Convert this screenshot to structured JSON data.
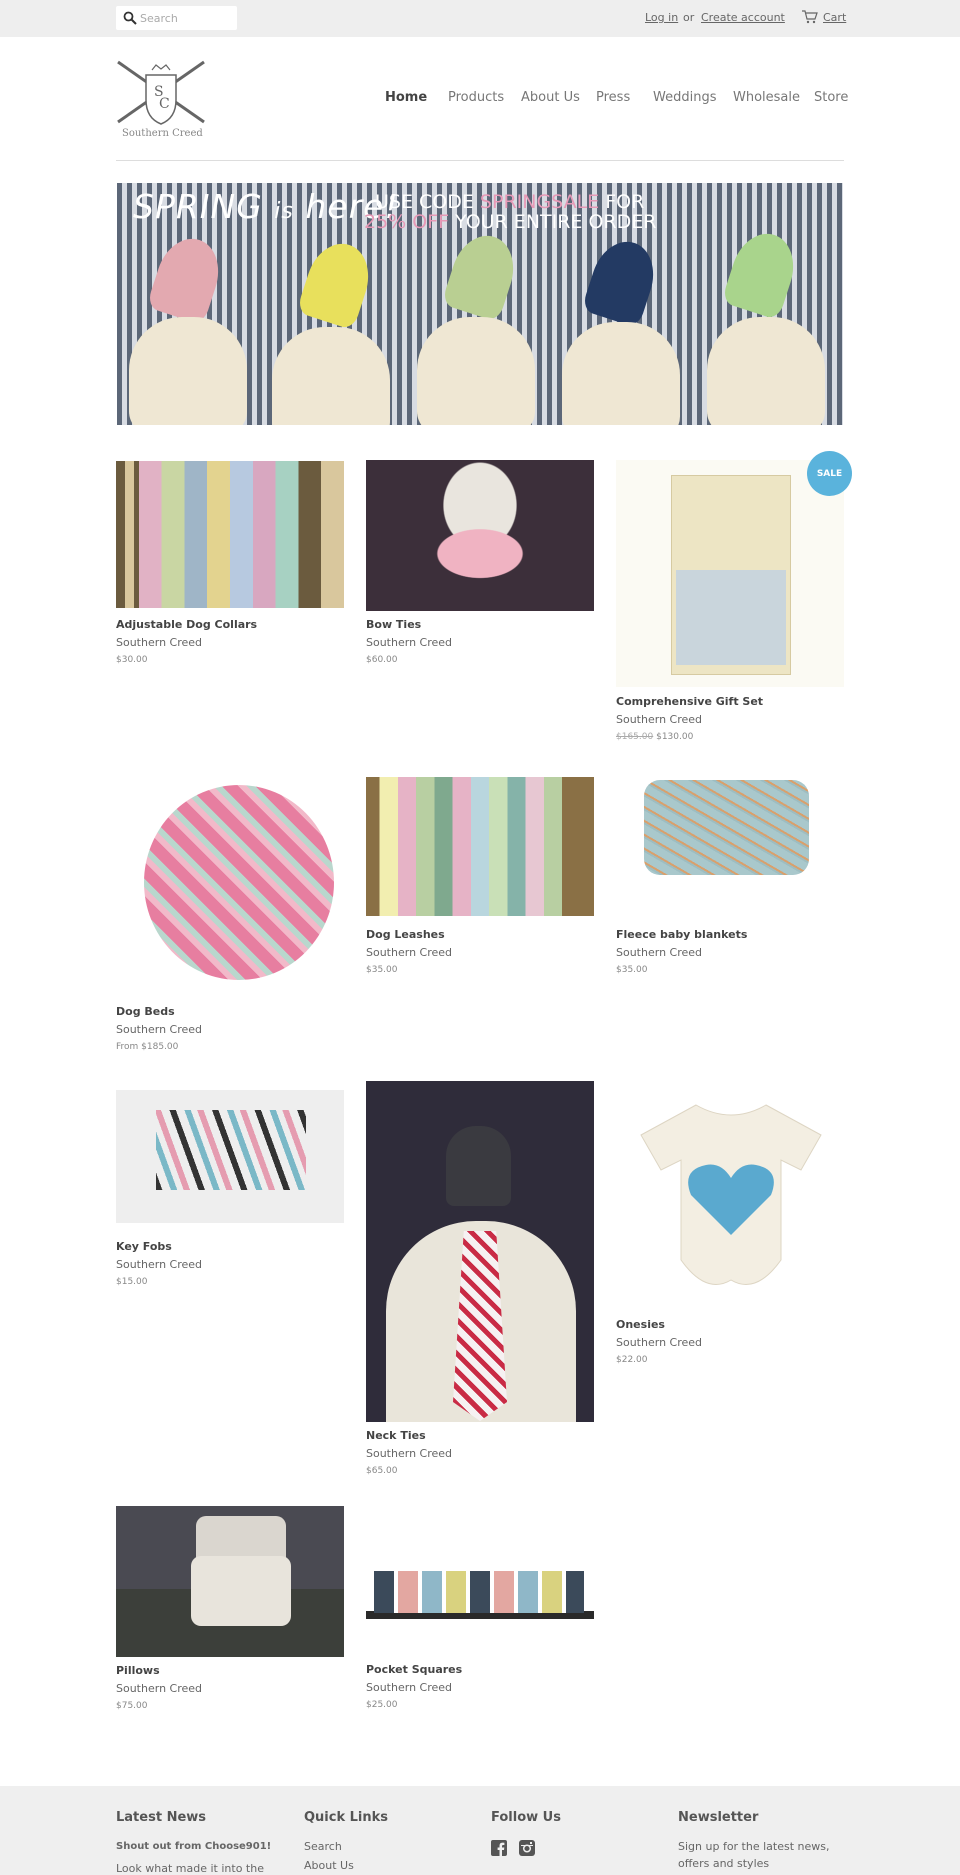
{
  "topbar": {
    "search_placeholder": "Search",
    "login": "Log in",
    "or": "or",
    "create_account": "Create account",
    "cart": "Cart"
  },
  "header": {
    "logo_text": "Southern Creed",
    "nav": [
      "Home",
      "Products",
      "About Us",
      "Press",
      "Weddings",
      "Wholesale",
      "Store"
    ]
  },
  "banner": {
    "headline_a": "SPRING",
    "headline_b": "is",
    "headline_c": "here!",
    "code_prefix": "USE CODE ",
    "code": "SPRINGSALE",
    "code_suffix": " FOR",
    "discount": "25% OFF",
    "discount_suffix": " YOUR ENTIRE ORDER"
  },
  "products": [
    {
      "title": "Adjustable Dog Collars",
      "vendor": "Southern Creed",
      "price": "$30.00"
    },
    {
      "title": "Bow Ties",
      "vendor": "Southern Creed",
      "price": "$60.00"
    },
    {
      "title": "Comprehensive Gift Set",
      "vendor": "Southern Creed",
      "compare_price": "$165.00",
      "price": "$130.00",
      "badge": "SALE"
    },
    {
      "title": "Dog Beds",
      "vendor": "Southern Creed",
      "price": "From $185.00"
    },
    {
      "title": "Dog Leashes",
      "vendor": "Southern Creed",
      "price": "$35.00"
    },
    {
      "title": "Fleece baby blankets",
      "vendor": "Southern Creed",
      "price": "$35.00"
    },
    {
      "title": "Key Fobs",
      "vendor": "Southern Creed",
      "price": "$15.00"
    },
    {
      "title": "Neck Ties",
      "vendor": "Southern Creed",
      "price": "$65.00"
    },
    {
      "title": "Onesies",
      "vendor": "Southern Creed",
      "price": "$22.00"
    },
    {
      "title": "Pillows",
      "vendor": "Southern Creed",
      "price": "$75.00"
    },
    {
      "title": "Pocket Squares",
      "vendor": "Southern Creed",
      "price": "$25.00"
    }
  ],
  "footer": {
    "news_heading": "Latest News",
    "news_post": "Shout out from Choose901!",
    "news_excerpt": "Look what made it into the",
    "links_heading": "Quick Links",
    "links": [
      "Search",
      "About Us"
    ],
    "follow_heading": "Follow Us",
    "social_icons": [
      "facebook-icon",
      "instagram-icon"
    ],
    "newsletter_heading": "Newsletter",
    "newsletter_text_1": "Sign up for the latest news,",
    "newsletter_text_2": "offers and styles"
  },
  "colors": {
    "sale_badge": "#5ab3dc",
    "topbar_bg": "#eeeeee",
    "footer_bg": "#efefef"
  }
}
